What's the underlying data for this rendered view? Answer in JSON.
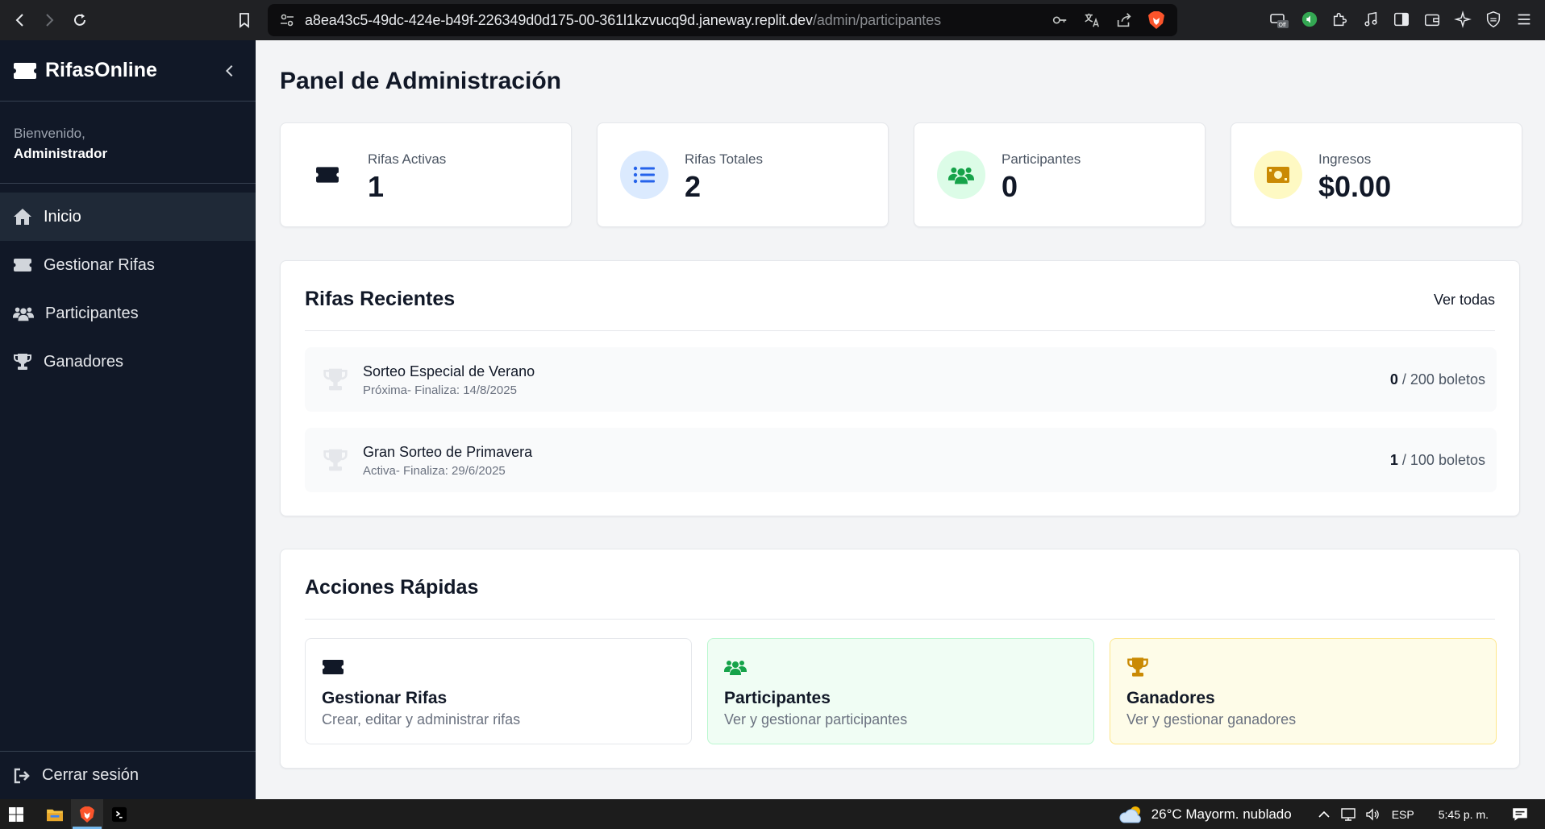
{
  "browser": {
    "url_host": "a8ea43c5-49dc-424e-b49f-226349d0d175-00-361l1kzvucq9d.janeway.replit.dev",
    "url_path": "/admin/participantes"
  },
  "sidebar": {
    "brand": "RifasOnline",
    "welcome_label": "Bienvenido,",
    "welcome_name": "Administrador",
    "items": [
      {
        "label": "Inicio",
        "icon": "home-icon"
      },
      {
        "label": "Gestionar Rifas",
        "icon": "ticket-icon"
      },
      {
        "label": "Participantes",
        "icon": "users-icon"
      },
      {
        "label": "Ganadores",
        "icon": "trophy-icon"
      }
    ],
    "logout": "Cerrar sesión"
  },
  "main": {
    "title": "Panel de Administración",
    "stats": [
      {
        "label": "Rifas Activas",
        "value": "1",
        "icon": "ticket-icon",
        "color": "#111827"
      },
      {
        "label": "Rifas Totales",
        "value": "2",
        "icon": "list-icon",
        "color": "#2563eb"
      },
      {
        "label": "Participantes",
        "value": "0",
        "icon": "users-icon",
        "color": "#16a34a"
      },
      {
        "label": "Ingresos",
        "value": "$0.00",
        "icon": "money-icon",
        "color": "#ca8a04"
      }
    ],
    "recent": {
      "title": "Rifas Recientes",
      "link": "Ver todas",
      "items": [
        {
          "name": "Sorteo Especial de Verano",
          "status": "Próxima",
          "end_label": "- Finaliza: 14/8/2025",
          "sold": "0",
          "total_label": " / 200 boletos"
        },
        {
          "name": "Gran Sorteo de Primavera",
          "status": "Activa",
          "end_label": "- Finaliza: 29/6/2025",
          "sold": "1",
          "total_label": " / 100 boletos"
        }
      ]
    },
    "quick": {
      "title": "Acciones Rápidas",
      "items": [
        {
          "title": "Gestionar Rifas",
          "desc": "Crear, editar y administrar rifas",
          "icon": "ticket-icon"
        },
        {
          "title": "Participantes",
          "desc": "Ver y gestionar participantes",
          "icon": "users-icon"
        },
        {
          "title": "Ganadores",
          "desc": "Ver y gestionar ganadores",
          "icon": "trophy-icon"
        }
      ]
    }
  },
  "taskbar": {
    "weather": "26°C  Mayorm. nublado",
    "language": "ESP",
    "time": "5:45 p. m."
  }
}
